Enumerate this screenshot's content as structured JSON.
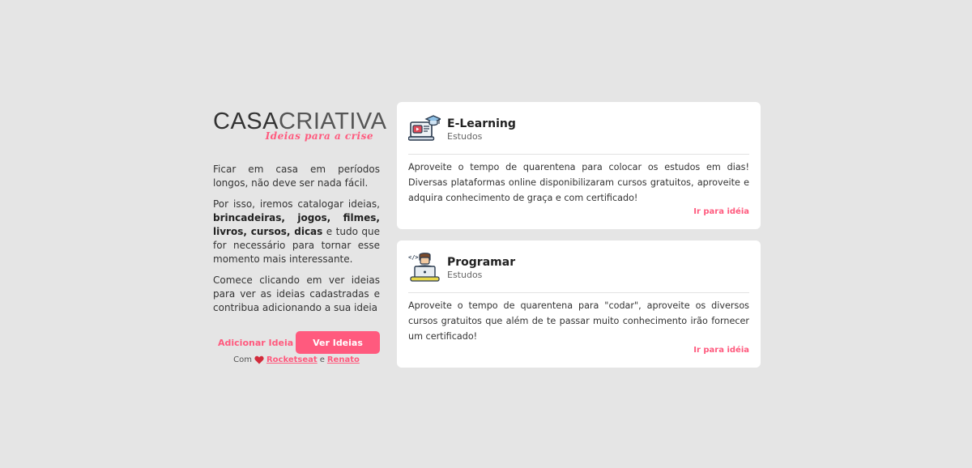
{
  "logo": {
    "main_bold": "CASA",
    "main_thin": "CRIATIVA",
    "tagline": "Ideias para a crise"
  },
  "intro": {
    "p1": "Ficar em casa em períodos longos, não deve ser nada fácil.",
    "p2_a": "Por isso, iremos catalogar ideias,",
    "p2_bold": "brincadeiras, jogos, filmes, livros, cursos, dicas",
    "p2_b": "e tudo que for necessário para tornar esse momento mais interessante.",
    "p3": "Comece clicando em ver ideias para ver as ideias cadastradas e contribua adicionando a sua ideia"
  },
  "actions": {
    "add_label": "Adicionar Ideia",
    "view_label": "Ver Ideias"
  },
  "credits": {
    "prefix": "Com",
    "author1": "Rocketseat",
    "joiner": "e",
    "author2": "Renato"
  },
  "colors": {
    "accent": "#ff5a7e",
    "background": "#e5e5e5"
  },
  "cards": [
    {
      "icon": "e-learning-icon",
      "title": "E-Learning",
      "category": "Estudos",
      "description": "Aproveite o tempo de quarentena para colocar os estudos em dias! Diversas plataformas online disponibilizaram cursos gratuitos, aproveite e adquira conhecimento de graça e com certificado!",
      "link": "Ir para idéia"
    },
    {
      "icon": "programmer-icon",
      "title": "Programar",
      "category": "Estudos",
      "description": "Aproveite o tempo de quarentena para \"codar\", aproveite os diversos cursos gratuitos que além de te passar muito conhecimento irão fornecer um certificado!",
      "link": "Ir para idéia"
    }
  ]
}
